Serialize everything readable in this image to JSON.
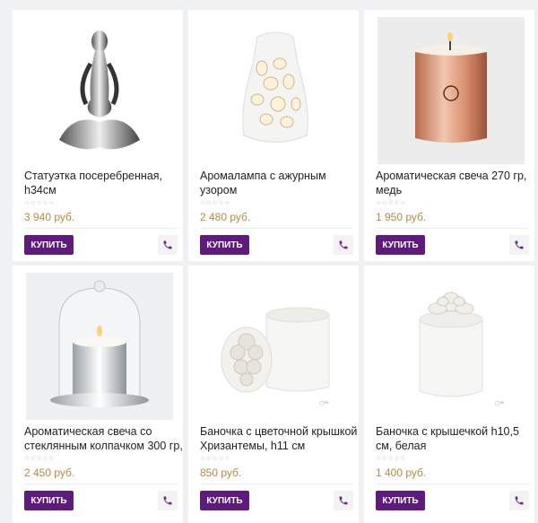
{
  "products": [
    {
      "title": "Статуэтка посеребренная, h34см",
      "rating_stars": "☆☆☆☆☆",
      "price": "3 940 руб.",
      "buy_label": "КУПИТЬ",
      "image_icon": "statuette-icon"
    },
    {
      "title": "Аромалампа с ажурным узором",
      "rating_stars": "☆☆☆☆☆",
      "price": "2 480 руб.",
      "buy_label": "КУПИТЬ",
      "image_icon": "aroma-lamp-icon"
    },
    {
      "title": "Ароматическая свеча 270 гр, медь",
      "rating_stars": "☆☆☆☆☆",
      "price": "1 950 руб.",
      "buy_label": "КУПИТЬ",
      "image_icon": "copper-candle-icon"
    },
    {
      "title": "Ароматическая свеча со стеклянным колпачком 300 гр,",
      "rating_stars": "☆☆☆☆☆",
      "price": "2 450 руб.",
      "buy_label": "КУПИТЬ",
      "image_icon": "glass-dome-candle-icon"
    },
    {
      "title": "Баночка с цветочной крышкой Хризантемы, h11 см",
      "rating_stars": "☆☆☆☆☆",
      "price": "850 руб.",
      "buy_label": "КУПИТЬ",
      "image_icon": "flower-lid-jar-icon"
    },
    {
      "title": "Баночка с крышечкой h10,5 см, белая",
      "rating_stars": "☆☆☆☆☆",
      "price": "1 400 руб.",
      "buy_label": "КУПИТЬ",
      "image_icon": "white-jar-icon"
    }
  ],
  "colors": {
    "buy_button": "#5e1a7c",
    "price": "#b58a3f",
    "phone_icon": "#6b2a8c"
  }
}
